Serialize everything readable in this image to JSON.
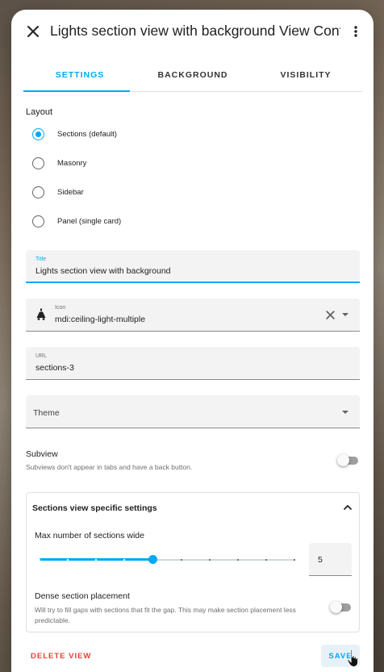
{
  "dialog": {
    "title": "Lights section view with background View Config",
    "close_icon": "close-icon",
    "menu_icon": "more-vertical-icon"
  },
  "tabs": [
    {
      "label": "SETTINGS",
      "active": true
    },
    {
      "label": "BACKGROUND",
      "active": false
    },
    {
      "label": "VISIBILITY",
      "active": false
    }
  ],
  "layout": {
    "label": "Layout",
    "options": [
      {
        "label": "Sections (default)",
        "checked": true
      },
      {
        "label": "Masonry",
        "checked": false
      },
      {
        "label": "Sidebar",
        "checked": false
      },
      {
        "label": "Panel (single card)",
        "checked": false
      }
    ]
  },
  "fields": {
    "title": {
      "label": "Title",
      "value": "Lights section view with background"
    },
    "icon": {
      "label": "Icon",
      "value": "mdi:ceiling-light-multiple",
      "icon": "ceiling-light-multiple-icon"
    },
    "url": {
      "label": "URL",
      "value": "sections-3"
    },
    "theme": {
      "label": "Theme",
      "value": ""
    }
  },
  "subview": {
    "title": "Subview",
    "description": "Subviews don't appear in tabs and have a back button.",
    "enabled": false
  },
  "sections_panel": {
    "title": "Sections view specific settings",
    "expanded": true,
    "max_sections": {
      "label": "Max number of sections wide",
      "value": "5",
      "min": 1,
      "max": 10
    },
    "dense": {
      "title": "Dense section placement",
      "description": "Will try to fill gaps with sections that fit the gap. This may make section placement less predictable.",
      "enabled": false
    }
  },
  "footer": {
    "delete_label": "DELETE VIEW",
    "save_label": "SAVE"
  },
  "colors": {
    "accent": "#03a9f4",
    "danger": "#db4437"
  }
}
